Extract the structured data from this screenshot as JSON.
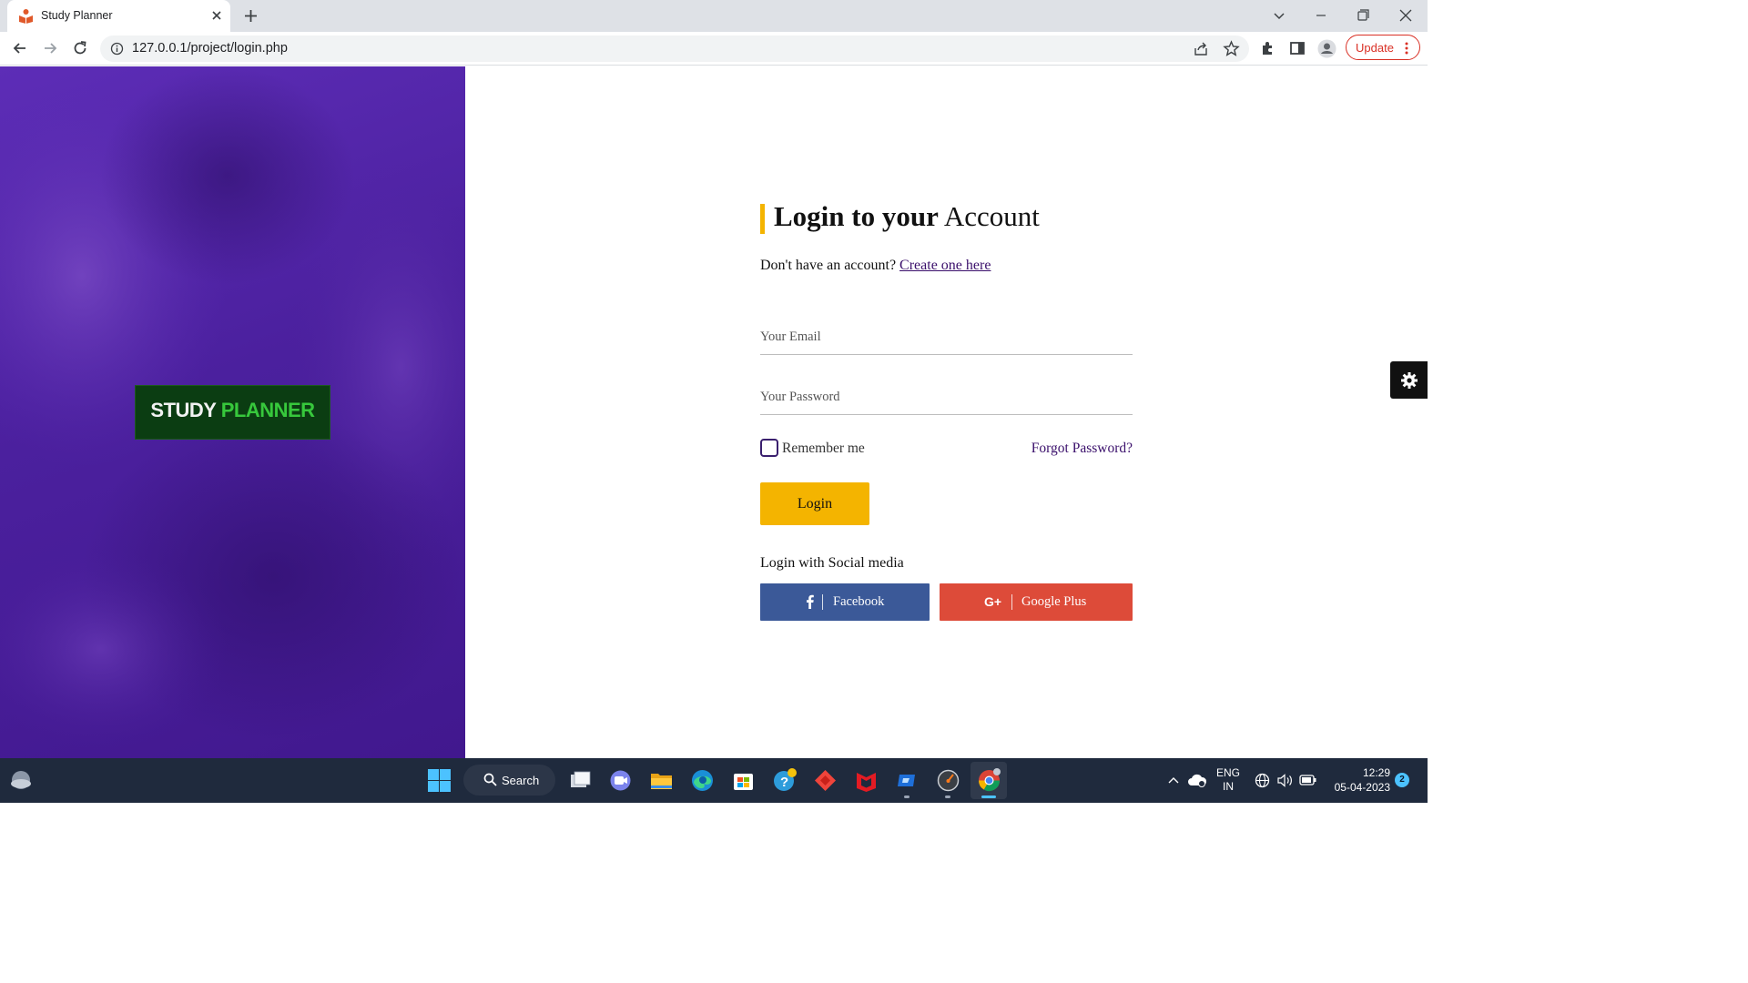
{
  "browser": {
    "tab_title": "Study Planner",
    "url": "127.0.0.1/project/login.php",
    "update_label": "Update"
  },
  "hero": {
    "logo_word1": "STUDY",
    "logo_word2": "PLANNER"
  },
  "login": {
    "heading_bold": "Login to your",
    "heading_regular": " Account",
    "signup_prompt": "Don't have an account? ",
    "signup_link": "Create one here",
    "email_placeholder": "Your Email",
    "password_placeholder": "Your Password",
    "remember_label": "Remember me",
    "forgot_label": "Forgot Password?",
    "login_button": "Login",
    "social_title": "Login with Social media",
    "facebook_label": "Facebook",
    "google_label": "Google Plus"
  },
  "taskbar": {
    "search_label": "Search",
    "lang_line1": "ENG",
    "lang_line2": "IN",
    "time": "12:29",
    "date": "05-04-2023",
    "notification_count": "2"
  },
  "colors": {
    "accent_yellow": "#f4b400",
    "hero_purple": "#4b209e",
    "facebook_blue": "#3b5998",
    "google_red": "#dd4b39",
    "link_purple": "#3a0f6b",
    "logo_green": "#37c83c"
  },
  "icons": [
    "study-planner-favicon",
    "tab-close-icon",
    "new-tab-icon",
    "tab-search-icon",
    "minimize-icon",
    "maximize-icon",
    "close-icon",
    "back-arrow-icon",
    "forward-arrow-icon",
    "reload-icon",
    "site-info-icon",
    "share-icon",
    "star-icon",
    "extensions-icon",
    "side-panel-icon",
    "profile-icon",
    "more-menu-icon",
    "facebook-icon",
    "google-plus-icon",
    "gear-icon",
    "weather-icon",
    "windows-start-icon",
    "search-icon",
    "task-view-icon",
    "teams-chat-icon",
    "file-explorer-icon",
    "edge-icon",
    "store-icon",
    "help-icon",
    "anydesk-icon",
    "mcafee-icon",
    "remote-app-icon",
    "speedometer-icon",
    "chrome-icon",
    "chevron-up-icon",
    "cloud-icon",
    "network-icon",
    "volume-icon",
    "battery-icon"
  ]
}
